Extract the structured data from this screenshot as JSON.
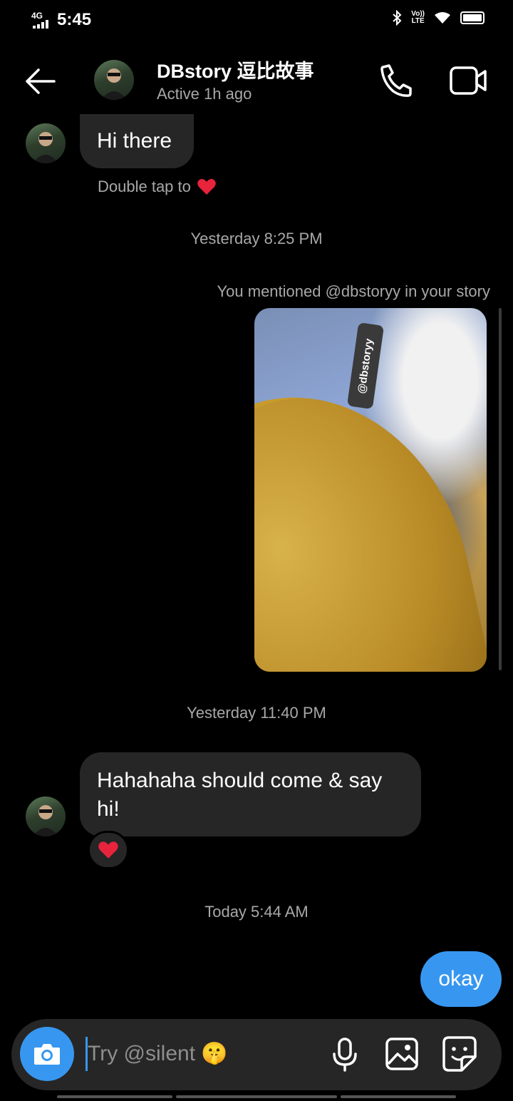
{
  "status_bar": {
    "time": "5:45",
    "network": "4G",
    "volte_top": "Vo))",
    "volte_bottom": "LTE"
  },
  "header": {
    "name": "DBstory 逗比故事",
    "status": "Active 1h ago",
    "icons": {
      "back": "back-arrow-icon",
      "call": "phone-icon",
      "video": "video-camera-icon"
    }
  },
  "messages": {
    "m1": {
      "text": "Hi there"
    },
    "double_tap": "Double tap to",
    "ts1": "Yesterday 8:25 PM",
    "story_caption": "You mentioned @dbstoryy in your story",
    "story_tag": "@dbstoryy",
    "ts2": "Yesterday 11:40 PM",
    "m2": {
      "text": "Hahahaha should come & say hi!"
    },
    "ts3": "Today 5:44 AM",
    "m3": {
      "text": "okay"
    },
    "reaction": "❤️"
  },
  "composer": {
    "placeholder": "Try @silent 🤫",
    "icons": [
      "camera-icon",
      "microphone-icon",
      "gallery-icon",
      "sticker-icon"
    ]
  },
  "colors": {
    "accent": "#3797f0",
    "bubble_in": "#262626",
    "background": "#000000"
  }
}
